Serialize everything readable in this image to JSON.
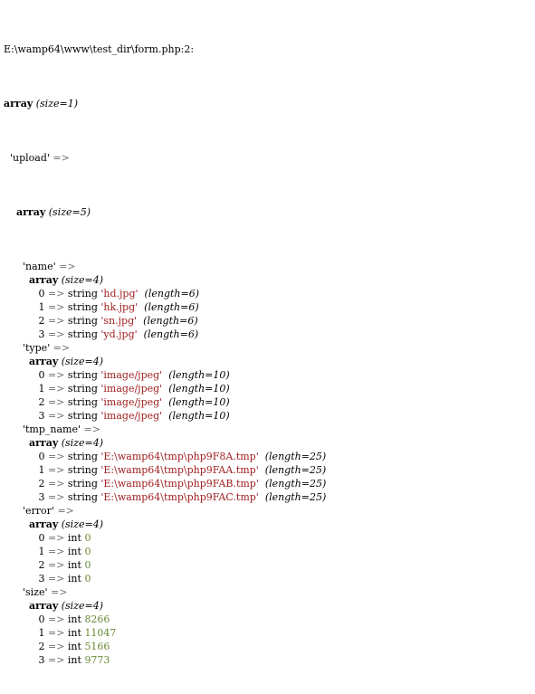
{
  "window": {
    "title": "var_dump output",
    "bg_color": "#ffffff",
    "text_color": "#000000",
    "string_color": "#a02020",
    "int_color": "#6a8a35",
    "arrow_color": "#707070"
  },
  "header": {
    "file_line": "E:\\wamp64\\www\\test_dir\\form.php:2:"
  },
  "tokens": {
    "array": "array",
    "arrow": "=>",
    "string": "string",
    "int": "int",
    "quote": "'",
    "paren_open": "(",
    "paren_close": ")"
  },
  "dump": {
    "root": {
      "type": "array",
      "size_label": "(size=1)",
      "key": "'upload'",
      "child": {
        "type": "array",
        "size_label": "(size=5)",
        "entries": [
          {
            "key": "'name'",
            "type": "array",
            "size_label": "(size=4)",
            "items": [
              {
                "index": "0",
                "kind": "string",
                "value": "'hd.jpg'",
                "length": "(length=6)"
              },
              {
                "index": "1",
                "kind": "string",
                "value": "'hk.jpg'",
                "length": "(length=6)"
              },
              {
                "index": "2",
                "kind": "string",
                "value": "'sn.jpg'",
                "length": "(length=6)"
              },
              {
                "index": "3",
                "kind": "string",
                "value": "'yd.jpg'",
                "length": "(length=6)"
              }
            ]
          },
          {
            "key": "'type'",
            "type": "array",
            "size_label": "(size=4)",
            "items": [
              {
                "index": "0",
                "kind": "string",
                "value": "'image/jpeg'",
                "length": "(length=10)"
              },
              {
                "index": "1",
                "kind": "string",
                "value": "'image/jpeg'",
                "length": "(length=10)"
              },
              {
                "index": "2",
                "kind": "string",
                "value": "'image/jpeg'",
                "length": "(length=10)"
              },
              {
                "index": "3",
                "kind": "string",
                "value": "'image/jpeg'",
                "length": "(length=10)"
              }
            ]
          },
          {
            "key": "'tmp_name'",
            "type": "array",
            "size_label": "(size=4)",
            "items": [
              {
                "index": "0",
                "kind": "string",
                "value": "'E:\\wamp64\\tmp\\php9F8A.tmp'",
                "length": "(length=25)"
              },
              {
                "index": "1",
                "kind": "string",
                "value": "'E:\\wamp64\\tmp\\php9FAA.tmp'",
                "length": "(length=25)"
              },
              {
                "index": "2",
                "kind": "string",
                "value": "'E:\\wamp64\\tmp\\php9FAB.tmp'",
                "length": "(length=25)"
              },
              {
                "index": "3",
                "kind": "string",
                "value": "'E:\\wamp64\\tmp\\php9FAC.tmp'",
                "length": "(length=25)"
              }
            ]
          },
          {
            "key": "'error'",
            "type": "array",
            "size_label": "(size=4)",
            "items": [
              {
                "index": "0",
                "kind": "int",
                "value": "0",
                "length": ""
              },
              {
                "index": "1",
                "kind": "int",
                "value": "0",
                "length": ""
              },
              {
                "index": "2",
                "kind": "int",
                "value": "0",
                "length": ""
              },
              {
                "index": "3",
                "kind": "int",
                "value": "0",
                "length": ""
              }
            ]
          },
          {
            "key": "'size'",
            "type": "array",
            "size_label": "(size=4)",
            "items": [
              {
                "index": "0",
                "kind": "int",
                "value": "8266",
                "length": ""
              },
              {
                "index": "1",
                "kind": "int",
                "value": "11047",
                "length": ""
              },
              {
                "index": "2",
                "kind": "int",
                "value": "5166",
                "length": ""
              },
              {
                "index": "3",
                "kind": "int",
                "value": "9773",
                "length": ""
              }
            ]
          }
        ]
      }
    }
  }
}
